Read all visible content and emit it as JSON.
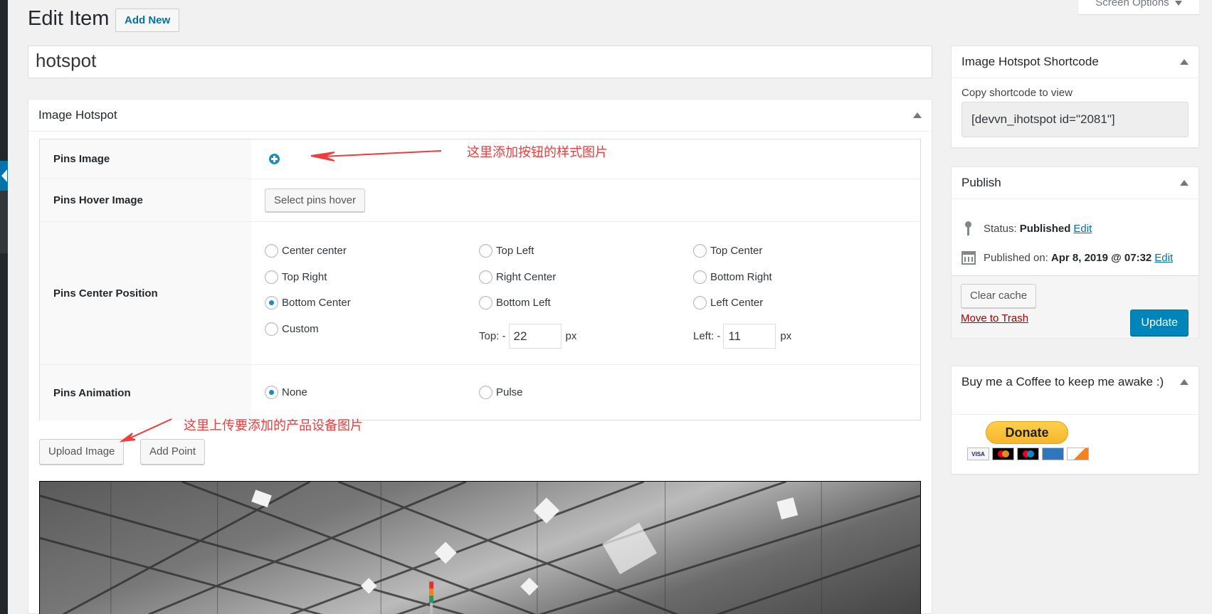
{
  "page": {
    "title": "Edit Item",
    "add_new_label": "Add New",
    "screen_options_label": "Screen Options",
    "post_title_value": "hotspot"
  },
  "hotspot_box": {
    "title": "Image Hotspot",
    "rows": {
      "pins_image": {
        "label": "Pins Image",
        "icon": "plus-circle-icon"
      },
      "pins_hover_image": {
        "label": "Pins Hover Image",
        "button_label": "Select pins hover"
      },
      "pins_center_position": {
        "label": "Pins Center Position",
        "options": [
          {
            "label": "Center center",
            "checked": false
          },
          {
            "label": "Top Left",
            "checked": false
          },
          {
            "label": "Top Center",
            "checked": false
          },
          {
            "label": "Top Right",
            "checked": false
          },
          {
            "label": "Right Center",
            "checked": false
          },
          {
            "label": "Bottom Right",
            "checked": false
          },
          {
            "label": "Bottom Center",
            "checked": true
          },
          {
            "label": "Bottom Left",
            "checked": false
          },
          {
            "label": "Left Center",
            "checked": false
          },
          {
            "label": "Custom",
            "checked": false
          }
        ],
        "top_label": "Top: -",
        "top_value": "22",
        "left_label": "Left: -",
        "left_value": "11",
        "unit": "px"
      },
      "pins_animation": {
        "label": "Pins Animation",
        "options": [
          {
            "label": "None",
            "checked": true
          },
          {
            "label": "Pulse",
            "checked": false
          }
        ]
      }
    },
    "upload_image_label": "Upload Image",
    "add_point_label": "Add Point",
    "image_description": "Industrial steel roof truss structure (grayscale) with a signal tower light"
  },
  "annotations": {
    "pins_image_note": "这里添加按钮的样式图片",
    "upload_note": "这里上传要添加的产品设备图片",
    "color": "#f03c3c"
  },
  "shortcode_box": {
    "title": "Image Hotspot Shortcode",
    "label": "Copy shortcode to view",
    "value": "[devvn_ihotspot id=\"2081\"]"
  },
  "publish_box": {
    "title": "Publish",
    "status_label": "Status:",
    "status_value": "Published",
    "status_edit": "Edit",
    "published_label": "Published on:",
    "published_value": "Apr 8, 2019 @ 07:32",
    "published_edit": "Edit",
    "clear_cache_label": "Clear cache",
    "trash_label": "Move to Trash",
    "update_label": "Update"
  },
  "coffee_box": {
    "title": "Buy me a Coffee to keep me awake :)",
    "donate_label": "Donate",
    "cards": [
      "VISA",
      "Mastercard",
      "Maestro",
      "American Express",
      "Discover"
    ]
  },
  "colors": {
    "accent": "#0073aa",
    "primary_button": "#0085ba",
    "radio_checked": "#1e8cbe",
    "trash": "#aa0000",
    "annotation": "#f03c3c"
  }
}
